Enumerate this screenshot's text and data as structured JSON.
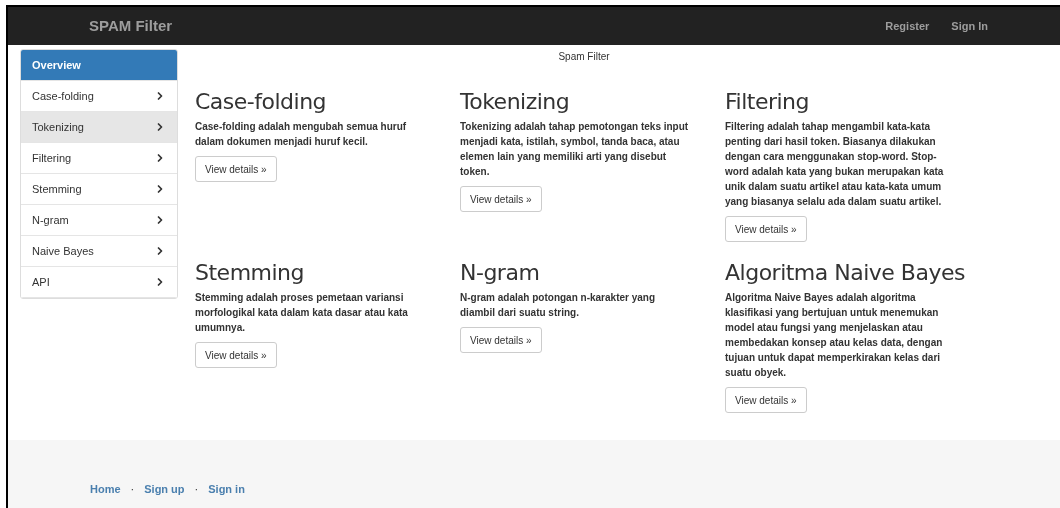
{
  "navbar": {
    "brand": "SPAM Filter",
    "links": [
      "Register",
      "Sign In"
    ]
  },
  "sidebar": {
    "items": [
      {
        "label": "Overview",
        "selected": true,
        "hovered": false,
        "chevron": false
      },
      {
        "label": "Case-folding",
        "selected": false,
        "hovered": false,
        "chevron": true
      },
      {
        "label": "Tokenizing",
        "selected": false,
        "hovered": true,
        "chevron": true
      },
      {
        "label": "Filtering",
        "selected": false,
        "hovered": false,
        "chevron": true
      },
      {
        "label": "Stemming",
        "selected": false,
        "hovered": false,
        "chevron": true
      },
      {
        "label": "N-gram",
        "selected": false,
        "hovered": false,
        "chevron": true
      },
      {
        "label": "Naive Bayes",
        "selected": false,
        "hovered": false,
        "chevron": true
      },
      {
        "label": "API",
        "selected": false,
        "hovered": false,
        "chevron": true
      }
    ]
  },
  "page_title": "Spam Filter",
  "sections": [
    {
      "title": "Case-folding",
      "text": "Case-folding adalah mengubah semua huruf dalam dokumen menjadi huruf kecil.",
      "button": "View details »"
    },
    {
      "title": "Tokenizing",
      "text": "Tokenizing adalah tahap pemotongan teks input menjadi kata, istilah, symbol, tanda baca, atau elemen lain yang memiliki arti yang disebut token.",
      "button": "View details »"
    },
    {
      "title": "Filtering",
      "text": "Filtering adalah tahap mengambil kata-kata penting dari hasil token. Biasanya dilakukan dengan cara menggunakan stop-word. Stop-word adalah kata yang bukan merupakan kata unik dalam suatu artikel atau kata-kata umum yang biasanya selalu ada dalam suatu artikel.",
      "button": "View details »"
    },
    {
      "title": "Stemming",
      "text": "Stemming adalah proses pemetaan variansi morfologikal kata dalam kata dasar atau kata umumnya.",
      "button": "View details »"
    },
    {
      "title": "N-gram",
      "text": "N-gram adalah potongan n-karakter yang diambil dari suatu string.",
      "button": "View details »"
    },
    {
      "title": "Algoritma Naive Bayes",
      "text": "Algoritma Naive Bayes adalah algoritma klasifikasi yang bertujuan untuk menemukan model atau fungsi yang menjelaskan atau membedakan konsep atau kelas data, dengan tujuan untuk dapat memperkirakan kelas dari suatu obyek.",
      "button": "View details »"
    }
  ],
  "footer": {
    "links": [
      "Home",
      "Sign up",
      "Sign in"
    ],
    "separator": "·"
  }
}
